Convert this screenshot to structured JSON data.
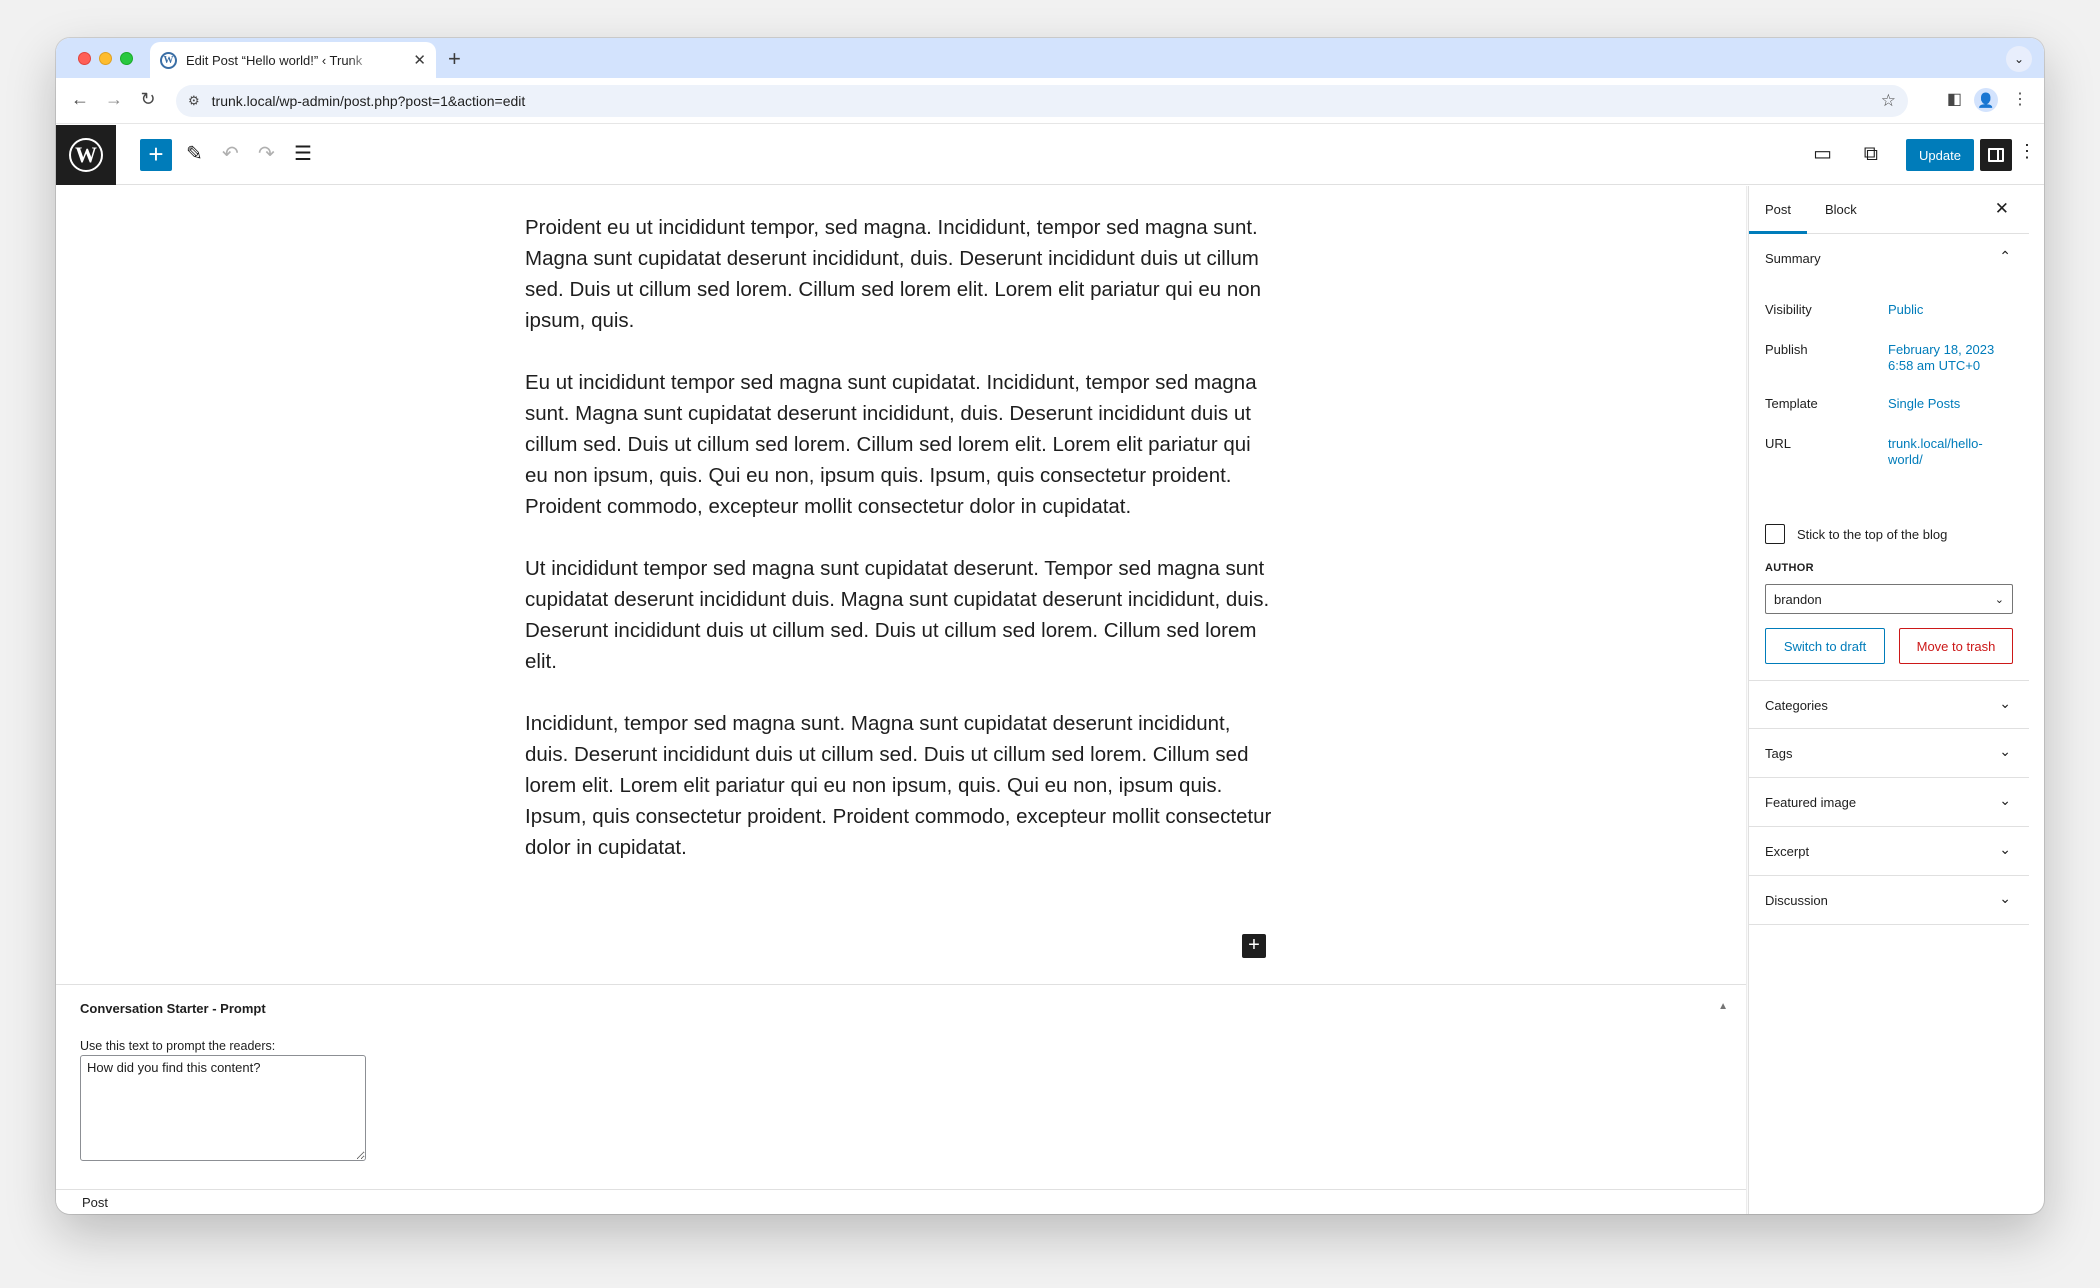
{
  "browser": {
    "tab_title": "Edit Post “Hello world!” ‹ Trunk",
    "url": "trunk.local/wp-admin/post.php?post=1&action=edit"
  },
  "icons": {
    "back": "←",
    "forward": "→",
    "reload": "↻",
    "site_info": "⚙",
    "star": "☆",
    "sidepanel": "◧",
    "profile": "👤",
    "menu": "⋮",
    "new_tab": "+",
    "close": "✕",
    "tab_search": "⌄",
    "inserter": "+",
    "pencil": "✎",
    "undo": "↶",
    "redo": "↷",
    "list_view": "☰",
    "view": "▭",
    "external": "⧉",
    "more": "⋮",
    "chevron_up": "⌃",
    "chevron_down": "⌄",
    "triangle_up": "▲",
    "caret": "⌄",
    "wp_logo": "W"
  },
  "wp_header": {
    "update_label": "Update"
  },
  "editor": {
    "paragraphs": [
      "Proident eu ut incididunt tempor, sed magna. Incididunt, tempor sed magna sunt. Magna sunt cupidatat deserunt incididunt, duis. Deserunt incididunt duis ut cillum sed. Duis ut cillum sed lorem. Cillum sed lorem elit. Lorem elit pariatur qui eu non ipsum, quis.",
      "Eu ut incididunt tempor sed magna sunt cupidatat. Incididunt, tempor sed magna sunt. Magna sunt cupidatat deserunt incididunt, duis. Deserunt incididunt duis ut cillum sed. Duis ut cillum sed lorem. Cillum sed lorem elit. Lorem elit pariatur qui eu non ipsum, quis. Qui eu non, ipsum quis. Ipsum, quis consectetur proident. Proident commodo, excepteur mollit consectetur dolor in cupidatat.",
      "Ut incididunt tempor sed magna sunt cupidatat deserunt. Tempor sed magna sunt cupidatat deserunt incididunt duis. Magna sunt cupidatat deserunt incididunt, duis. Deserunt incididunt duis ut cillum sed. Duis ut cillum sed lorem. Cillum sed lorem elit.",
      "Incididunt, tempor sed magna sunt. Magna sunt cupidatat deserunt incididunt, duis. Deserunt incididunt duis ut cillum sed. Duis ut cillum sed lorem. Cillum sed lorem elit. Lorem elit pariatur qui eu non ipsum, quis. Qui eu non, ipsum quis. Ipsum, quis consectetur proident. Proident commodo, excepteur mollit consectetur dolor in cupidatat."
    ]
  },
  "metabox": {
    "title": "Conversation Starter - Prompt",
    "label": "Use this text to prompt the readers:",
    "value": "How did you find this content?"
  },
  "footer": {
    "breadcrumb": "Post"
  },
  "sidebar": {
    "tabs": [
      "Post",
      "Block"
    ],
    "summary": {
      "title": "Summary",
      "visibility_label": "Visibility",
      "visibility_value": "Public",
      "publish_label": "Publish",
      "publish_value_line1": "February 18, 2023",
      "publish_value_line2": "6:58 am UTC+0",
      "template_label": "Template",
      "template_value": "Single Posts",
      "url_label": "URL",
      "url_value_line1": "trunk.local/hello-",
      "url_value_line2": "world/",
      "sticky_label": "Stick to the top of the blog",
      "author_label": "AUTHOR",
      "author_value": "brandon",
      "switch_draft": "Switch to draft",
      "move_trash": "Move to trash"
    },
    "panels": [
      "Categories",
      "Tags",
      "Featured image",
      "Excerpt",
      "Discussion"
    ]
  },
  "colors": {
    "accent": "#007cba",
    "danger": "#cc1818",
    "dark": "#1e1e1e",
    "tabstrip": "#d3e3fd"
  }
}
